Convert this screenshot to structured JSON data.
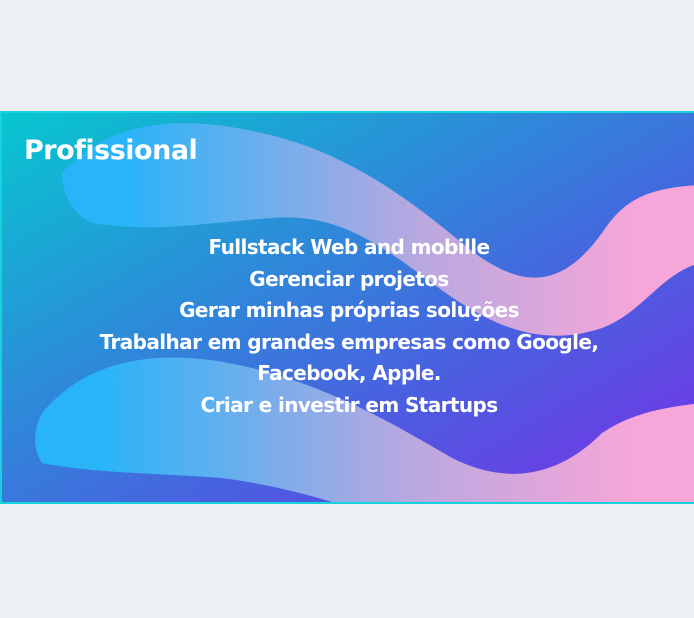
{
  "card": {
    "title": "Profissional",
    "items": [
      "Fullstack Web and mobille",
      "Gerenciar projetos",
      "Gerar minhas próprias soluções",
      "Trabalhar em grandes empresas como Google,",
      "Facebook, Apple.",
      "Criar e investir em Startups"
    ]
  },
  "colors": {
    "border": "#16d2dc",
    "gradient_start": "#07c6d0",
    "gradient_end": "#7a2ee6",
    "brush_start": "#2ab4f8",
    "brush_end": "#f6a6d8",
    "page_background": "#edf0f3"
  }
}
